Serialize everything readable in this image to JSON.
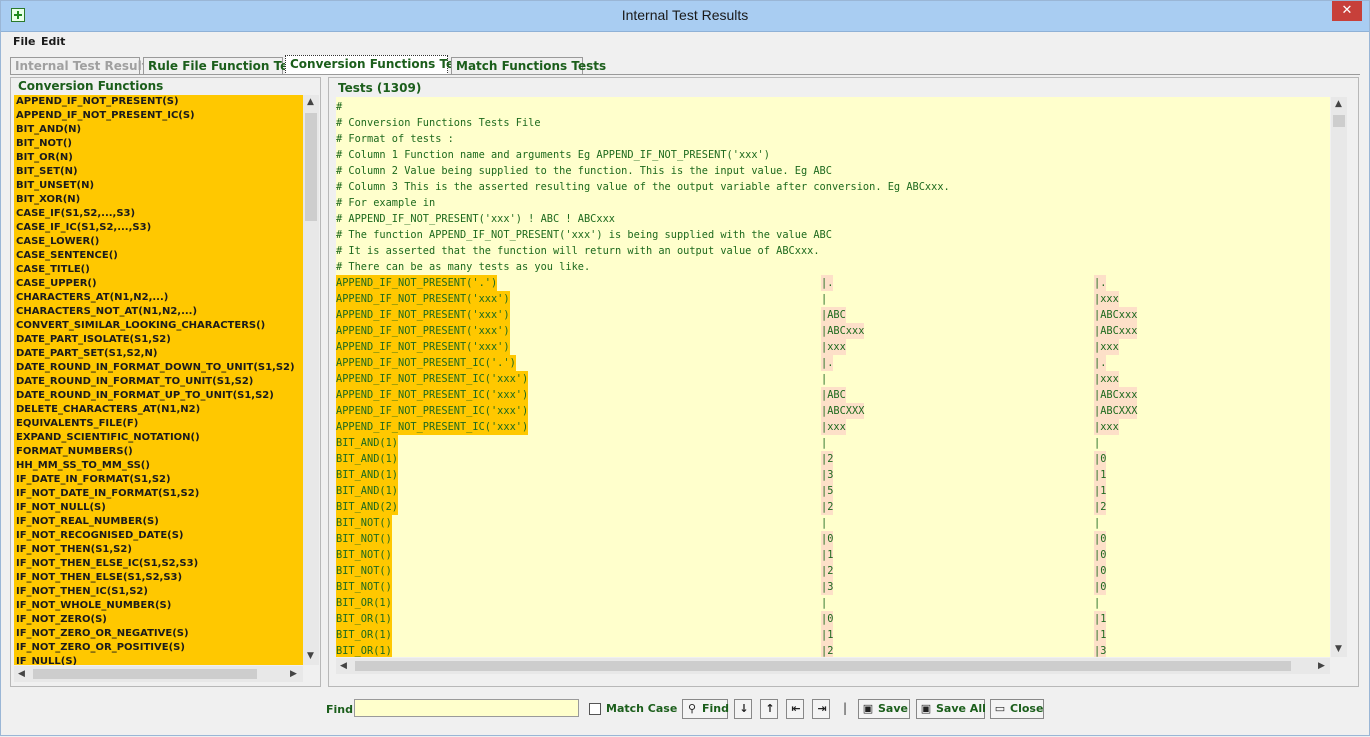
{
  "window": {
    "title": "Internal Test Results",
    "close_glyph": "✕"
  },
  "menu": [
    "File",
    "Edit"
  ],
  "tabs": [
    {
      "label": "Internal Test Results",
      "state": "disabled"
    },
    {
      "label": "Rule File Function Tests",
      "state": "normal"
    },
    {
      "label": "Conversion Functions Tests",
      "state": "active"
    },
    {
      "label": "Match Functions Tests",
      "state": "normal"
    }
  ],
  "left_panel": {
    "title": "Conversion Functions",
    "functions": [
      "APPEND_IF_NOT_PRESENT(S)",
      "APPEND_IF_NOT_PRESENT_IC(S)",
      "BIT_AND(N)",
      "BIT_NOT()",
      "BIT_OR(N)",
      "BIT_SET(N)",
      "BIT_UNSET(N)",
      "BIT_XOR(N)",
      "CASE_IF(S1,S2,...,S3)",
      "CASE_IF_IC(S1,S2,...,S3)",
      "CASE_LOWER()",
      "CASE_SENTENCE()",
      "CASE_TITLE()",
      "CASE_UPPER()",
      "CHARACTERS_AT(N1,N2,...)",
      "CHARACTERS_NOT_AT(N1,N2,...)",
      "CONVERT_SIMILAR_LOOKING_CHARACTERS()",
      "DATE_PART_ISOLATE(S1,S2)",
      "DATE_PART_SET(S1,S2,N)",
      "DATE_ROUND_IN_FORMAT_DOWN_TO_UNIT(S1,S2)",
      "DATE_ROUND_IN_FORMAT_TO_UNIT(S1,S2)",
      "DATE_ROUND_IN_FORMAT_UP_TO_UNIT(S1,S2)",
      "DELETE_CHARACTERS_AT(N1,N2)",
      "EQUIVALENTS_FILE(F)",
      "EXPAND_SCIENTIFIC_NOTATION()",
      "FORMAT_NUMBERS()",
      "HH_MM_SS_TO_MM_SS()",
      "IF_DATE_IN_FORMAT(S1,S2)",
      "IF_NOT_DATE_IN_FORMAT(S1,S2)",
      "IF_NOT_NULL(S)",
      "IF_NOT_REAL_NUMBER(S)",
      "IF_NOT_RECOGNISED_DATE(S)",
      "IF_NOT_THEN(S1,S2)",
      "IF_NOT_THEN_ELSE_IC(S1,S2,S3)",
      "IF_NOT_THEN_ELSE(S1,S2,S3)",
      "IF_NOT_THEN_IC(S1,S2)",
      "IF_NOT_WHOLE_NUMBER(S)",
      "IF_NOT_ZERO(S)",
      "IF_NOT_ZERO_OR_NEGATIVE(S)",
      "IF_NOT_ZERO_OR_POSITIVE(S)",
      "IF_NULL(S)"
    ]
  },
  "tests_panel": {
    "title": "Tests (1309)",
    "comments": [
      "#",
      "# Conversion Functions Tests File",
      "# Format of tests :",
      "# Column 1 Function name and arguments Eg APPEND_IF_NOT_PRESENT('xxx')",
      "# Column 2 Value being supplied to the function. This is the input value. Eg ABC",
      "# Column 3 This is the asserted resulting value of the output variable after conversion. Eg ABCxxx.",
      "# For example in",
      "# APPEND_IF_NOT_PRESENT('xxx') ! ABC ! ABCxxx",
      "# The function APPEND_IF_NOT_PRESENT('xxx') is being supplied with the value ABC",
      "# It is asserted that the function will return with an output value of ABCxxx.",
      "# There can be as many tests as you like."
    ],
    "rows": [
      [
        "APPEND_IF_NOT_PRESENT('.')",
        "|.",
        "|."
      ],
      [
        "APPEND_IF_NOT_PRESENT('xxx')",
        "|",
        "|xxx"
      ],
      [
        "APPEND_IF_NOT_PRESENT('xxx')",
        "|ABC",
        "|ABCxxx"
      ],
      [
        "APPEND_IF_NOT_PRESENT('xxx')",
        "|ABCxxx",
        "|ABCxxx"
      ],
      [
        "APPEND_IF_NOT_PRESENT('xxx')",
        "|xxx",
        "|xxx"
      ],
      [
        "APPEND_IF_NOT_PRESENT_IC('.')",
        "|.",
        "|."
      ],
      [
        "APPEND_IF_NOT_PRESENT_IC('xxx')",
        "|",
        "|xxx"
      ],
      [
        "APPEND_IF_NOT_PRESENT_IC('xxx')",
        "|ABC",
        "|ABCxxx"
      ],
      [
        "APPEND_IF_NOT_PRESENT_IC('xxx')",
        "|ABCXXX",
        "|ABCXXX"
      ],
      [
        "APPEND_IF_NOT_PRESENT_IC('xxx')",
        "|xxx",
        "|xxx"
      ],
      [
        "BIT_AND(1)",
        "|",
        "|"
      ],
      [
        "BIT_AND(1)",
        "|2",
        "|0"
      ],
      [
        "BIT_AND(1)",
        "|3",
        "|1"
      ],
      [
        "BIT_AND(1)",
        "|5",
        "|1"
      ],
      [
        "BIT_AND(2)",
        "|2",
        "|2"
      ],
      [
        "BIT_NOT()",
        "|",
        "|"
      ],
      [
        "BIT_NOT()",
        "|0",
        "|0"
      ],
      [
        "BIT_NOT()",
        "|1",
        "|0"
      ],
      [
        "BIT_NOT()",
        "|2",
        "|0"
      ],
      [
        "BIT_NOT()",
        "|3",
        "|0"
      ],
      [
        "BIT_OR(1)",
        "|",
        "|"
      ],
      [
        "BIT_OR(1)",
        "|0",
        "|1"
      ],
      [
        "BIT_OR(1)",
        "|1",
        "|1"
      ],
      [
        "BIT_OR(1)",
        "|2",
        "|3"
      ]
    ]
  },
  "bottom": {
    "find_label": "Find",
    "find_value": "",
    "match_case_label": "Match Case",
    "match_case_checked": false,
    "find_button": "Find",
    "separator": "|",
    "save_button": "Save",
    "save_all_button": "Save All",
    "close_button": "Close"
  },
  "colors": {
    "list_highlight": "#ffc800",
    "tests_background": "#ffffcc",
    "text_green": "#1e6a1e",
    "value_highlight": "#fde0c8"
  }
}
